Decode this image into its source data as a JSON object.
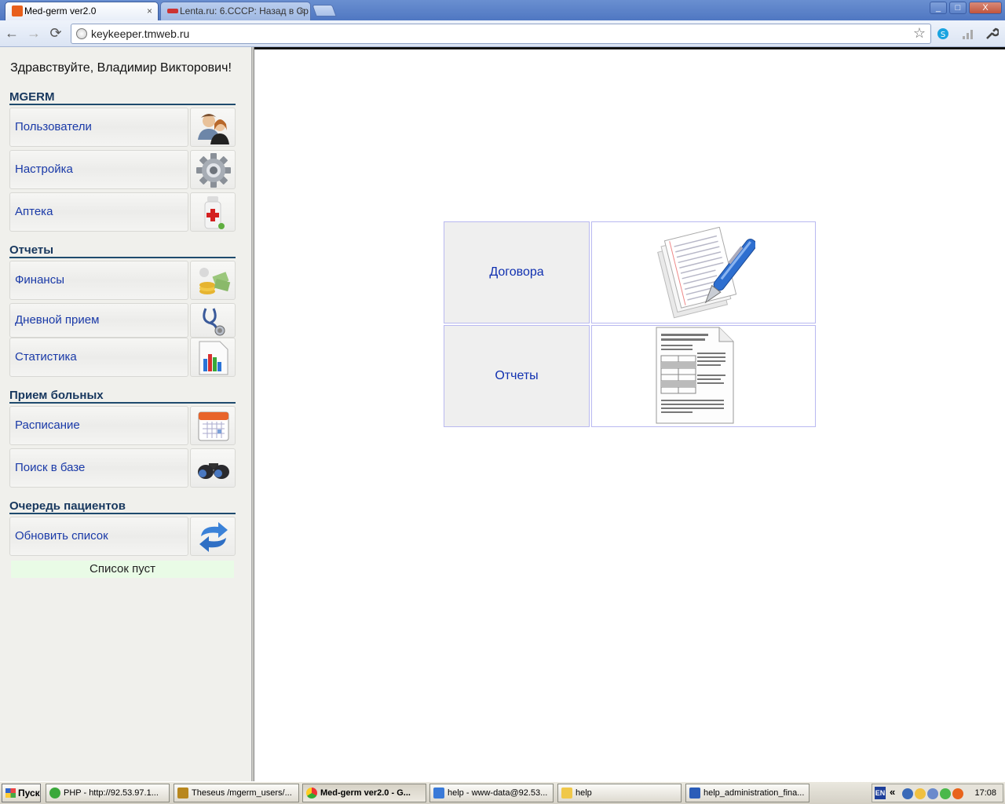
{
  "browser": {
    "tabs": [
      {
        "title": "Med-germ ver2.0",
        "active": true
      },
      {
        "title": "Lenta.ru: 6.СССР: Назад в Ср",
        "active": false
      }
    ],
    "close_glyph": "×",
    "window_buttons": [
      "_",
      "□",
      "X"
    ],
    "nav": {
      "back": "←",
      "forward": "→",
      "reload": "⟳"
    },
    "url": "keykeeper.tmweb.ru",
    "star_glyph": "☆"
  },
  "sidebar": {
    "greeting": "Здравствуйте, Владимир Викторович!",
    "sections": [
      {
        "title": "MGERM",
        "items": [
          {
            "label": "Пользователи",
            "icon": "users-icon"
          },
          {
            "label": "Настройка",
            "icon": "gear-icon"
          },
          {
            "label": "Аптека",
            "icon": "medicine-bottle-icon"
          }
        ]
      },
      {
        "title": "Отчеты",
        "items": [
          {
            "label": "Финансы",
            "icon": "money-icon"
          },
          {
            "label": "Дневной прием",
            "icon": "stethoscope-icon"
          },
          {
            "label": "Статистика",
            "icon": "bar-chart-icon"
          }
        ]
      },
      {
        "title": "Прием больных",
        "items": [
          {
            "label": "Расписание",
            "icon": "calendar-icon"
          },
          {
            "label": "Поиск в базе",
            "icon": "binoculars-icon"
          }
        ]
      },
      {
        "title": "Очередь пациентов",
        "items": [
          {
            "label": "Обновить список",
            "icon": "refresh-icon"
          }
        ]
      }
    ],
    "queue_status": "Список пуст"
  },
  "main": {
    "grid": [
      {
        "label": "Договора",
        "icon": "contract-pen-icon"
      },
      {
        "label": "Отчеты",
        "icon": "report-document-icon"
      }
    ]
  },
  "taskbar": {
    "start_label": "Пуск",
    "tasks": [
      {
        "label": "PHP - http://92.53.97.1...",
        "active": false
      },
      {
        "label": "Theseus /mgerm_users/...",
        "active": false
      },
      {
        "label": "Med-germ ver2.0 - G...",
        "active": true
      },
      {
        "label": "help - www-data@92.53...",
        "active": false
      },
      {
        "label": "help",
        "active": false
      },
      {
        "label": "help_administration_fina...",
        "active": false
      }
    ],
    "language": "EN",
    "tray_chevron": "«",
    "clock": "17:08"
  },
  "colors": {
    "link": "#1a3aa8",
    "section_title": "#17375e",
    "queue_bg": "#e9fbe6",
    "cell_border": "#b9b9f0"
  }
}
